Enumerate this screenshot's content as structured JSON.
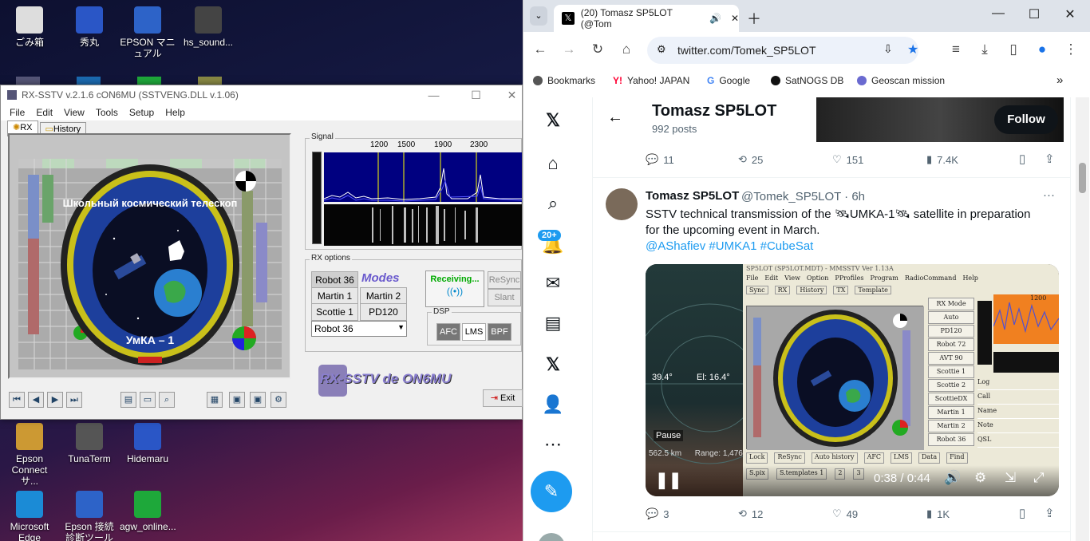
{
  "desktop": {
    "icons": [
      {
        "label": "ごみ箱",
        "color": "#ddd"
      },
      {
        "label": "秀丸",
        "color": "#2a56c6"
      },
      {
        "label": "EPSON マニュアル",
        "color": "#2d63c8"
      },
      {
        "label": "hs_sound...",
        "color": "#444"
      },
      {
        "label": "Epson Connect サ...",
        "color": "#c93"
      },
      {
        "label": "TunaTerm",
        "color": "#555"
      },
      {
        "label": "Hidemaru",
        "color": "#2a56c6"
      },
      {
        "label": "Microsoft Edge",
        "color": "#1b8bd6"
      },
      {
        "label": "Epson 接続診断ツール",
        "color": "#2d63c8"
      },
      {
        "label": "agw_online...",
        "color": "#1ea83a"
      }
    ]
  },
  "sstv": {
    "title": "RX-SSTV v.2.1.6 cON6MU (SSTVENG.DLL v.1.06)",
    "menu": [
      "File",
      "Edit",
      "View",
      "Tools",
      "Setup",
      "Help"
    ],
    "tabs": [
      "RX",
      "History"
    ],
    "image_text_top": "Школьный космический телескоп",
    "image_text_bottom": "УмКА – 1",
    "signal_label": "Signal",
    "freq_ticks": [
      "1200",
      "1500",
      "1900",
      "2300"
    ],
    "rx_options_label": "RX options",
    "modes": [
      "Robot 36",
      "Martin 1",
      "Martin 2",
      "Scottie 1",
      "PD120"
    ],
    "modes_logo": "Modes",
    "selected_mode": "Robot 36",
    "receiving": "Receiving...",
    "resync": "ReSync",
    "slant": "Slant",
    "dsp_label": "DSP",
    "dsp_buttons": [
      "AFC",
      "LMS",
      "BPF"
    ],
    "logo": "RX-SSTV de ON6MU",
    "exit": "Exit"
  },
  "browser": {
    "tab_title": "(20) Tomasz SP5LOT (@Tom",
    "url": "twitter.com/Tomek_SP5LOT",
    "bookmarks": [
      "Bookmarks",
      "Yahoo! JAPAN",
      "Google",
      "SatNOGS DB",
      "Geoscan mission"
    ],
    "notif_badge": "20+",
    "profile": {
      "name": "Tomasz SP5LOT",
      "posts": "992 posts",
      "follow": "Follow"
    },
    "prev_stats": {
      "replies": "11",
      "reposts": "25",
      "likes": "151",
      "views": "7.4K"
    },
    "tweet": {
      "name": "Tomasz SP5LOT",
      "handle_time": "@Tomek_SP5LOT · 6h",
      "text_1": "SSTV technical transmission of the",
      "text_2": "UMKA-1",
      "text_3": "satellite in preparation",
      "text_4": "for the upcoming event in March.",
      "tags": "@AShafiev #UMKA1 #CubeSat",
      "more": "···",
      "stats": {
        "replies": "3",
        "reposts": "12",
        "likes": "49",
        "views": "1K"
      }
    },
    "video": {
      "pause": "Pause",
      "az": "39.4°",
      "el": "El: 16.4°",
      "range": "562.5 km      Range: 1,476",
      "time": "0:38 / 0:44",
      "mmsstv_title": "SP5LOT (SP5LOT.MDT) - MMSSTV Ver 1.13A",
      "mmsstv_menu": [
        "File",
        "Edit",
        "View",
        "Option",
        "PProfiles",
        "Program",
        "RadioCommand",
        "Help"
      ],
      "mmsstv_tabs": [
        "Sync",
        "RX",
        "History",
        "TX",
        "Template"
      ],
      "rx_modes": [
        "RX Mode",
        "Auto",
        "PD120",
        "Robot 72",
        "AVT 90",
        "Scottie 1",
        "Scottie 2",
        "ScottieDX",
        "Martin 1",
        "Martin 2",
        "Robot 36"
      ],
      "log": [
        "Log",
        "Call",
        "Name",
        "Note",
        "QSL"
      ],
      "bottom": [
        "Lock",
        "ReSync",
        "Auto history",
        "AFC",
        "LMS",
        "Data",
        "Find"
      ],
      "bottom2": [
        "S.pix",
        "S.templates 1",
        "2",
        "3"
      ],
      "freq": "1200"
    }
  }
}
